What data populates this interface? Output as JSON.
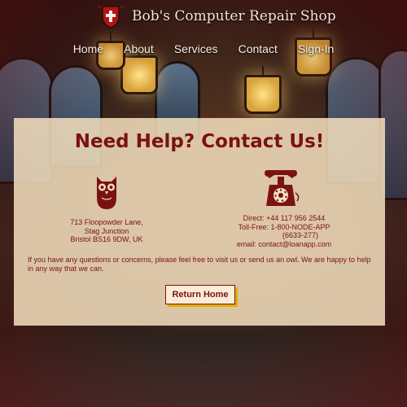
{
  "header": {
    "title": "Bob's Computer Repair Shop",
    "logo_icon": "shield-cross-crest-icon"
  },
  "nav": {
    "items": [
      {
        "label": "Home"
      },
      {
        "label": "About"
      },
      {
        "label": "Services"
      },
      {
        "label": "Contact"
      },
      {
        "label": "Sign-In"
      }
    ]
  },
  "contact": {
    "heading": "Need Help? Contact Us!",
    "address": {
      "icon": "owl-icon",
      "line1": "713 Floopowder Lane,",
      "line2": "Stag Junction",
      "line3": "Bristol BS16 9DW, UK"
    },
    "phone": {
      "icon": "rotary-telephone-icon",
      "direct": "Direct: +44 117 956 2544",
      "tollfree": "Toll-Free: 1-800-NODE-APP",
      "tollfree_digits": "(6633-277)",
      "email": "email: contact@loanapp.com"
    },
    "message": "If you have any questions or concerns, please feel free to visit us or send us an owl. We are happy to help in any way that we can.",
    "return_button": "Return Home"
  },
  "colors": {
    "accent": "#7a1212",
    "panel": "#f4e0be",
    "button_shadow": "#e0b000"
  }
}
